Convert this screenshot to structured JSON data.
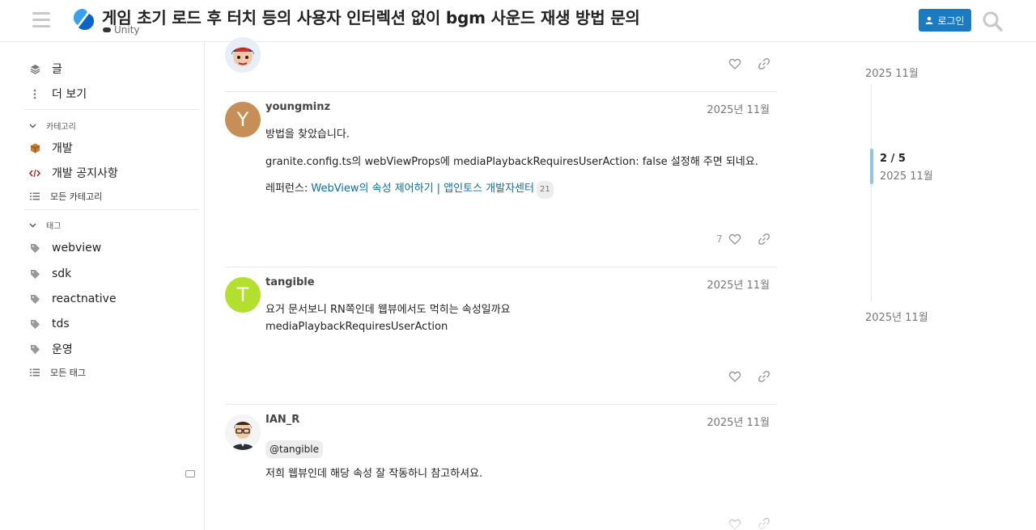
{
  "header": {
    "title": "게임 초기 로드 후 터치 등의 사용자 인터렉션 없이 bgm 사운드 재생 방법 문의",
    "category": "Unity",
    "login_label": "로그인"
  },
  "sidebar": {
    "items": [
      {
        "label": "글",
        "icon": "layers-icon"
      },
      {
        "label": "더 보기",
        "icon": "more-vertical-icon"
      }
    ],
    "categories_header": "카테고리",
    "categories": [
      {
        "label": "개발",
        "icon": "package-icon"
      },
      {
        "label": "개발 공지사항",
        "icon": "code-icon"
      }
    ],
    "all_categories": "모든 카테고리",
    "tags_header": "태그",
    "tags": [
      "webview",
      "sdk",
      "reactnative",
      "tds",
      "운영"
    ],
    "all_tags": "모든 태그"
  },
  "posts": [
    {
      "username": "youngminz",
      "avatar_letter": "Y",
      "avatar_color": "#c58f57",
      "date": "2025년 11월",
      "line1": "방법을 찾았습니다.",
      "line2": "granite.config.ts의 webViewProps에 mediaPlaybackRequiresUserAction: false 설정해 주면 되네요.",
      "ref_prefix": "레퍼런스: ",
      "ref_link": "WebView의 속성 제어하기 | 앱인토스 개발자센터",
      "ref_clicks": "21",
      "likes": "7"
    },
    {
      "username": "tangible",
      "avatar_letter": "T",
      "avatar_color": "#b3e02f",
      "date": "2025년 11월",
      "line1": "요거 문서보니 RN쪽인데 웹뷰에서도 먹히는 속성일까요",
      "line2": "mediaPlaybackRequiresUserAction"
    },
    {
      "username": "IAN_R",
      "date": "2025년 11월",
      "mention": "@tangible",
      "line1": "저희 웹뷰인데 해당 속성 잘 작동하니 참고하셔요."
    }
  ],
  "timeline": {
    "top_date": "2025 11월",
    "position": "2 / 5",
    "position_date": "2025 11월",
    "bottom_date": "2025년 11월"
  },
  "colors": {
    "accent": "#1a7ac2",
    "link": "#0a6ea8",
    "timeline_handle": "#8dc5ec"
  }
}
